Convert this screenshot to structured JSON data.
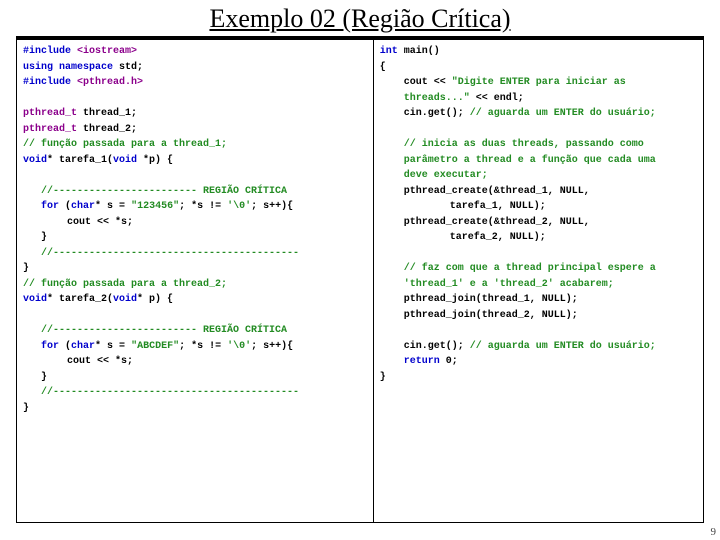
{
  "title": "Exemplo 02 (Região Crítica)",
  "page_num": "9",
  "left": {
    "l1a": "#include ",
    "l1b": "<iostream>",
    "l2a": "using namespace ",
    "l2b": "std;",
    "l3a": "#include ",
    "l3b": "<pthread.h>",
    "l4a": "pthread_t ",
    "l4b": "thread_1;",
    "l5a": "pthread_t ",
    "l5b": "thread_2;",
    "l6": "// função passada para a thread_1;",
    "l7a": "void",
    "l7b": "* tarefa_1(",
    "l7c": "void",
    "l7d": " *p) {",
    "l8": "//------------------------ REGIÃO CRÍTICA",
    "l9a": "for ",
    "l9b": "(",
    "l9c": "char",
    "l9d": "* s = ",
    "l9e": "\"123456\"",
    "l9f": "; *s != ",
    "l9g": "'\\0'",
    "l9h": "; s++){",
    "l10": "cout << *s;",
    "l11": "}",
    "l12": "//-----------------------------------------",
    "l13": "}",
    "l14": "// função passada para a thread_2;",
    "l15a": "void",
    "l15b": "* tarefa_2(",
    "l15c": "void",
    "l15d": "* p) {",
    "l16": "//------------------------ REGIÃO CRÍTICA",
    "l17a": "for ",
    "l17b": "(",
    "l17c": "char",
    "l17d": "* s = ",
    "l17e": "\"ABCDEF\"",
    "l17f": "; *s != ",
    "l17g": "'\\0'",
    "l17h": "; s++){",
    "l18": "cout << *s;",
    "l19": "}",
    "l20": "//-----------------------------------------",
    "l21": "}"
  },
  "right": {
    "r1a": "int ",
    "r1b": "main()",
    "r2": "{",
    "r3a": "cout << ",
    "r3b": "\"Digite ENTER para iniciar as",
    "r3c": "threads...\" ",
    "r3d": "<< endl;",
    "r4a": "cin.get(); ",
    "r4b": "// aguarda um ENTER do usuário;",
    "r5a": "// inicia as duas threads, passando como",
    "r5b": "parâmetro a thread e a função que cada uma",
    "r5c": "deve executar;",
    "r6": "pthread_create(&thread_1, NULL,",
    "r7": "tarefa_1, NULL);",
    "r8": "pthread_create(&thread_2, NULL,",
    "r9": "tarefa_2, NULL);",
    "r10a": "// faz com que a thread principal espere a",
    "r10b": "'thread_1' e a 'thread_2' acabarem;",
    "r11": "pthread_join(thread_1, NULL);",
    "r12": "pthread_join(thread_2, NULL);",
    "r13a": "cin.get(); ",
    "r13b": "// aguarda um ENTER do usuário;",
    "r14a": "return ",
    "r14b": "0;",
    "r15": "}"
  }
}
